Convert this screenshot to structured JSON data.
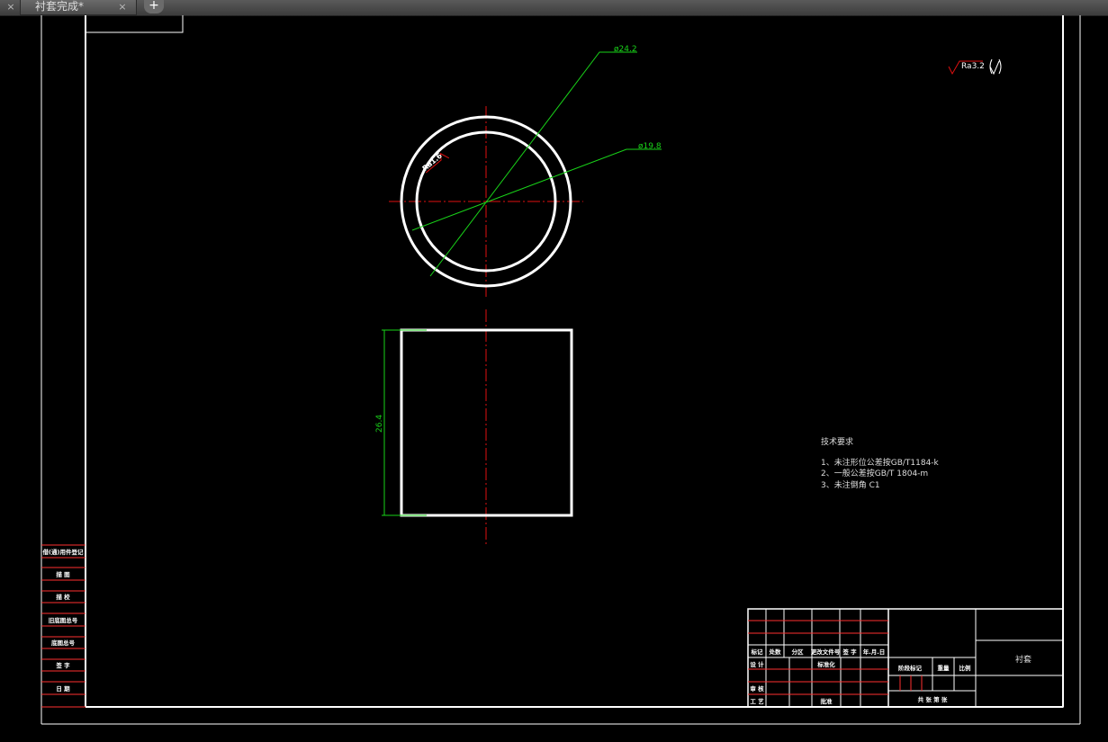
{
  "tabs": [
    {
      "label": "",
      "active": false
    },
    {
      "label": "衬套完成*",
      "active": true
    }
  ],
  "new_tab_label": "+",
  "close_glyph": "×",
  "dimensions": {
    "outer_diameter": "ø24.2",
    "inner_diameter": "ø19.8",
    "height": "26.4",
    "chamfer_roughness": "Ra1.6",
    "global_roughness": "Ra3.2"
  },
  "tech_requirements": {
    "title": "技术要求",
    "items": [
      "1、未注形位公差按GB/T1184-k",
      "2、一般公差按GB/T 1804-m",
      "3、未注倒角 C1"
    ]
  },
  "side_table_labels": [
    "借(通)用件登记",
    "描 图",
    "描 校",
    "旧底图总号",
    "底图总号",
    "签 字",
    "日 期"
  ],
  "title_block": {
    "part_name": "衬套",
    "header_row": [
      "标记",
      "处数",
      "分区",
      "更改文件号",
      "签 字",
      "年.月.日"
    ],
    "design": "设 计",
    "standardize": "标准化",
    "review": "审 核",
    "process": "工 艺",
    "approve": "批准",
    "stage_mark": "阶段标记",
    "weight": "重量",
    "scale": "比例",
    "sheets": "共  张  第  张"
  },
  "colors": {
    "outline": "#ffffff",
    "centerline": "#e01010",
    "dimension": "#19d219",
    "table_red": "#ff3030"
  }
}
